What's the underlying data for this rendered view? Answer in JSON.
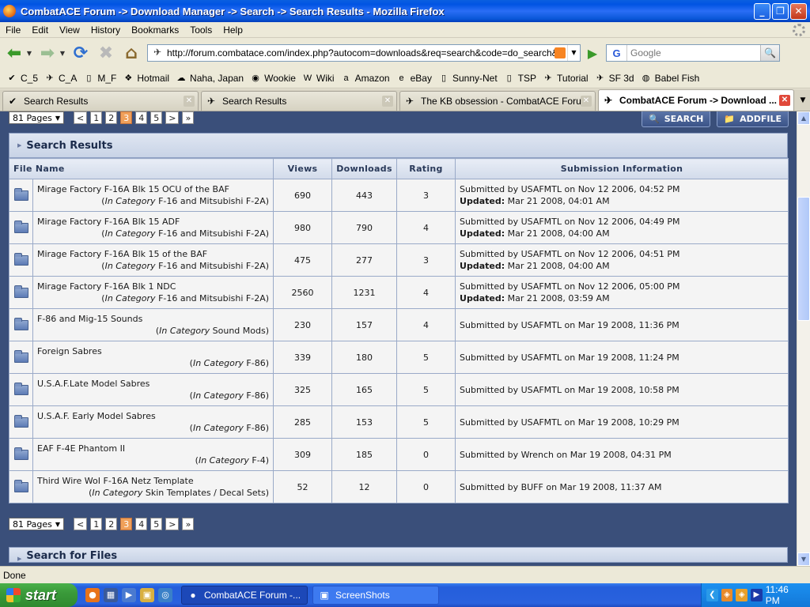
{
  "window": {
    "title": "CombatACE Forum -> Download Manager -> Search -> Search Results - Mozilla Firefox",
    "minimize": "_",
    "maximize": "❐",
    "close": "✕"
  },
  "menu": [
    "File",
    "Edit",
    "View",
    "History",
    "Bookmarks",
    "Tools",
    "Help"
  ],
  "nav": {
    "url": "http://forum.combatace.com/index.php?autocom=downloads&req=search&code=do_search&sort_by=D",
    "search_placeholder": "Google",
    "search_engine": "G"
  },
  "bookmarks": [
    {
      "label": "C_5",
      "icon": "✔"
    },
    {
      "label": "C_A",
      "icon": "✈"
    },
    {
      "label": "M_F",
      "icon": "▯"
    },
    {
      "label": "Hotmail",
      "icon": "❖"
    },
    {
      "label": "Naha, Japan",
      "icon": "☁"
    },
    {
      "label": "Wookie",
      "icon": "◉"
    },
    {
      "label": "Wiki",
      "icon": "W"
    },
    {
      "label": "Amazon",
      "icon": "a"
    },
    {
      "label": "eBay",
      "icon": "e"
    },
    {
      "label": "Sunny-Net",
      "icon": "▯"
    },
    {
      "label": "TSP",
      "icon": "▯"
    },
    {
      "label": "Tutorial",
      "icon": "✈"
    },
    {
      "label": "SF 3d",
      "icon": "✈"
    },
    {
      "label": "Babel Fish",
      "icon": "◍"
    }
  ],
  "tabs": [
    {
      "label": "Search Results",
      "active": false
    },
    {
      "label": "Search Results",
      "active": false
    },
    {
      "label": "The KB obsession - CombatACE Forum",
      "active": false
    },
    {
      "label": "CombatACE Forum -> Download ...",
      "active": true
    }
  ],
  "pagination": {
    "pages_label": "81 Pages",
    "prev": "<",
    "next": ">",
    "last": "»",
    "pages": [
      "1",
      "2",
      "3",
      "4",
      "5"
    ],
    "current": "3"
  },
  "top_buttons": {
    "search": "SEARCH",
    "addfile": "ADDFILE"
  },
  "results": {
    "heading": "Search Results",
    "columns": {
      "file_name": "File Name",
      "views": "Views",
      "downloads": "Downloads",
      "rating": "Rating",
      "submission": "Submission Information"
    },
    "rows": [
      {
        "name": "Mirage Factory F-16A Blk 15 OCU of the BAF",
        "cat_open": "(",
        "cat_word": "In Category",
        "category": "F-16 and Mitsubishi F-2A)",
        "views": "690",
        "downloads": "443",
        "rating": "3",
        "submitted": "Submitted by USAFMTL on Nov 12 2006, 04:52 PM",
        "updated_label": "Updated:",
        "updated": "Mar 21 2008, 04:01 AM"
      },
      {
        "name": "Mirage Factory F-16A Blk 15 ADF",
        "cat_open": "(",
        "cat_word": "In Category",
        "category": "F-16 and Mitsubishi F-2A)",
        "views": "980",
        "downloads": "790",
        "rating": "4",
        "submitted": "Submitted by USAFMTL on Nov 12 2006, 04:49 PM",
        "updated_label": "Updated:",
        "updated": "Mar 21 2008, 04:00 AM"
      },
      {
        "name": "Mirage Factory F-16A Blk 15 of the BAF",
        "cat_open": "(",
        "cat_word": "In Category",
        "category": "F-16 and Mitsubishi F-2A)",
        "views": "475",
        "downloads": "277",
        "rating": "3",
        "submitted": "Submitted by USAFMTL on Nov 12 2006, 04:51 PM",
        "updated_label": "Updated:",
        "updated": "Mar 21 2008, 04:00 AM"
      },
      {
        "name": "Mirage Factory F-16A Blk 1 NDC",
        "cat_open": "(",
        "cat_word": "In Category",
        "category": "F-16 and Mitsubishi F-2A)",
        "views": "2560",
        "downloads": "1231",
        "rating": "4",
        "submitted": "Submitted by USAFMTL on Nov 12 2006, 05:00 PM",
        "updated_label": "Updated:",
        "updated": "Mar 21 2008, 03:59 AM"
      },
      {
        "name": "F-86 and Mig-15 Sounds",
        "cat_open": "(",
        "cat_word": "In Category",
        "category": "Sound Mods)",
        "views": "230",
        "downloads": "157",
        "rating": "4",
        "submitted": "Submitted by USAFMTL on Mar 19 2008, 11:36 PM",
        "updated_label": "",
        "updated": ""
      },
      {
        "name": "Foreign Sabres",
        "cat_open": "(",
        "cat_word": "In Category",
        "category": "F-86)",
        "views": "339",
        "downloads": "180",
        "rating": "5",
        "submitted": "Submitted by USAFMTL on Mar 19 2008, 11:24 PM",
        "updated_label": "",
        "updated": ""
      },
      {
        "name": "U.S.A.F.Late Model Sabres",
        "cat_open": "(",
        "cat_word": "In Category",
        "category": "F-86)",
        "views": "325",
        "downloads": "165",
        "rating": "5",
        "submitted": "Submitted by USAFMTL on Mar 19 2008, 10:58 PM",
        "updated_label": "",
        "updated": ""
      },
      {
        "name": "U.S.A.F. Early Model Sabres",
        "cat_open": "(",
        "cat_word": "In Category",
        "category": "F-86)",
        "views": "285",
        "downloads": "153",
        "rating": "5",
        "submitted": "Submitted by USAFMTL on Mar 19 2008, 10:29 PM",
        "updated_label": "",
        "updated": ""
      },
      {
        "name": "EAF F-4E Phantom II",
        "cat_open": "(",
        "cat_word": "In Category",
        "category": "F-4)",
        "views": "309",
        "downloads": "185",
        "rating": "0",
        "submitted": "Submitted by Wrench on Mar 19 2008, 04:31 PM",
        "updated_label": "",
        "updated": ""
      },
      {
        "name": "Third Wire WoI F-16A Netz Template",
        "cat_open": "(",
        "cat_word": "In Category",
        "category": "Skin Templates / Decal Sets)",
        "views": "52",
        "downloads": "12",
        "rating": "0",
        "submitted": "Submitted by BUFF on Mar 19 2008, 11:37 AM",
        "updated_label": "",
        "updated": ""
      }
    ]
  },
  "search_for_files": "Search for Files",
  "status": "Done",
  "taskbar": {
    "start": "start",
    "items": [
      {
        "label": "CombatACE Forum -...",
        "active": true
      },
      {
        "label": "ScreenShots",
        "active": false
      }
    ],
    "clock": "11:46 PM"
  },
  "colors": {
    "content_bg": "#3a4f7a",
    "current_page": "#f0a05a",
    "titlebar": "#0054e3"
  }
}
